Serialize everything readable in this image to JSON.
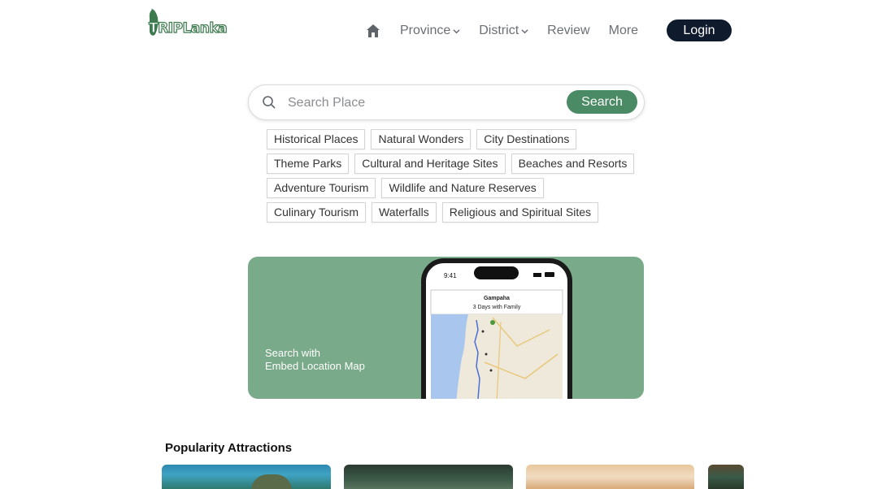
{
  "header": {
    "logo_text": "TRIPLanka",
    "nav": {
      "province": "Province",
      "district": "District",
      "review": "Review",
      "more": "More"
    },
    "login_label": "Login"
  },
  "search": {
    "placeholder": "Search Place",
    "button_label": "Search"
  },
  "categories": {
    "row1": [
      "Historical Places",
      "Natural Wonders",
      "City Destinations"
    ],
    "row2": [
      "Theme Parks",
      "Cultural and Heritage Sites",
      "Beaches and Resorts"
    ],
    "row3": [
      "Adventure Tourism",
      "Wildlife and Nature Reserves"
    ],
    "row4": [
      "Culinary Tourism",
      "Waterfalls",
      "Religious and Spiritual Sites"
    ]
  },
  "banner": {
    "line1": "Search with",
    "line2": "Embed Location Map",
    "phone_time": "9:41",
    "phone_title": "Gampaha",
    "phone_subtitle": "3 Days with Family"
  },
  "section": {
    "title": "Popularity Attractions"
  },
  "colors": {
    "brand_green": "#4a8a64",
    "banner_green": "#79aa89",
    "login_dark": "#0f1b2d"
  }
}
